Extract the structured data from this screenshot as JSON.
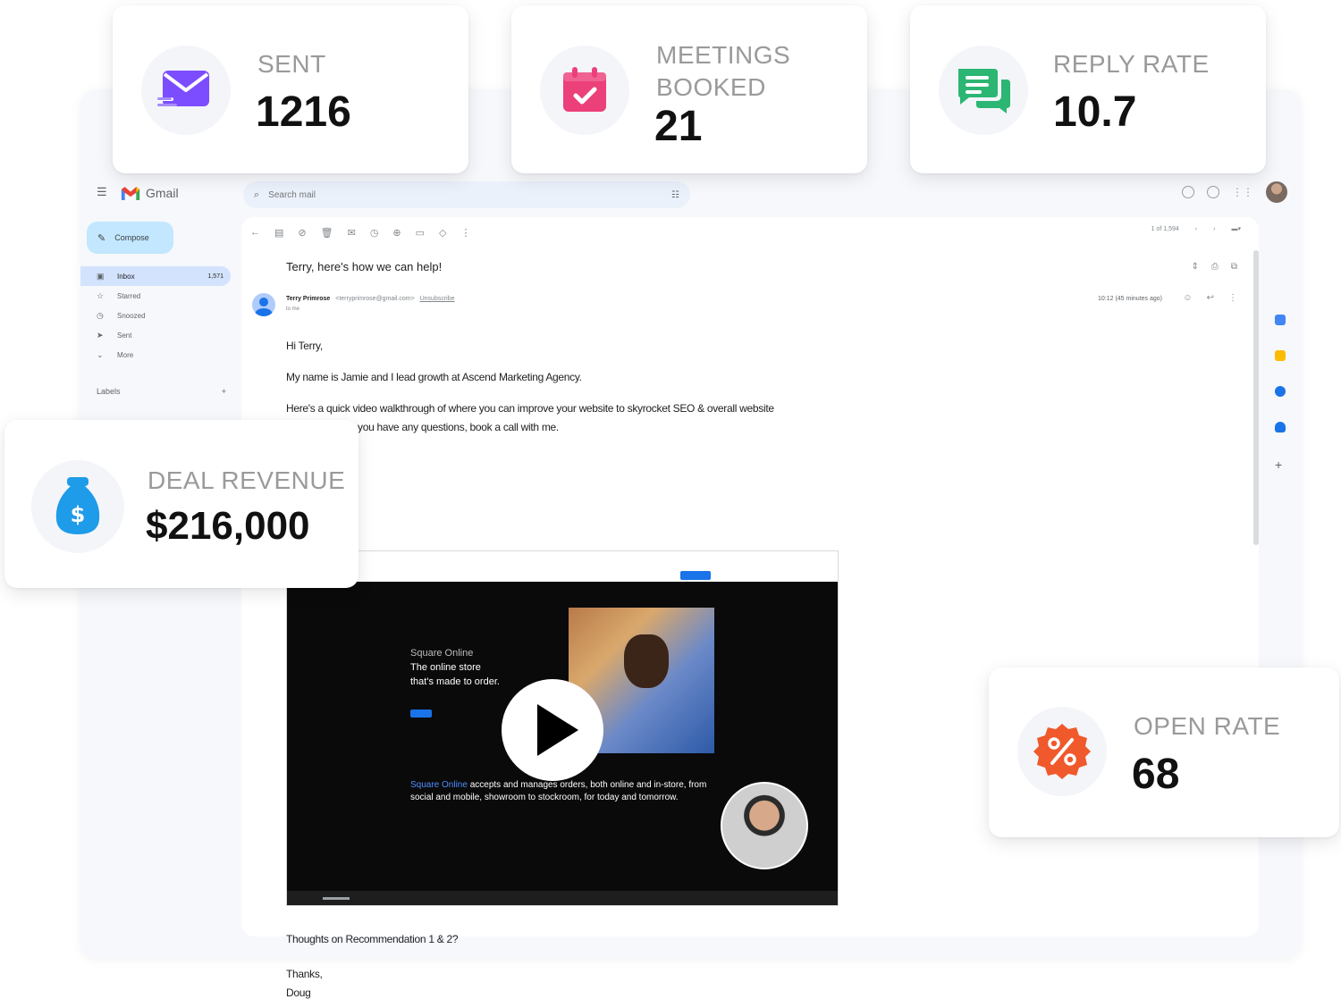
{
  "stats": {
    "sent": {
      "label": "SENT",
      "value": "1216",
      "color": "#7c4dff"
    },
    "meetings": {
      "label_line1": "MEETINGS",
      "label_line2": "BOOKED",
      "value": "21",
      "color": "#ec407a"
    },
    "reply_rate": {
      "label": "REPLY RATE",
      "value": "10.7",
      "color": "#2bb673"
    },
    "deal_revenue": {
      "label": "DEAL REVENUE",
      "value": "$216,000",
      "color": "#1e9be9"
    },
    "open_rate": {
      "label": "OPEN RATE",
      "value": "68",
      "color": "#f0592b"
    }
  },
  "gmail": {
    "app_name": "Gmail",
    "search_placeholder": "Search mail",
    "compose_label": "Compose",
    "nav": [
      {
        "label": "Inbox",
        "count": "1,571",
        "icon": "inbox-icon"
      },
      {
        "label": "Starred",
        "icon": "star-icon"
      },
      {
        "label": "Snoozed",
        "icon": "clock-icon"
      },
      {
        "label": "Sent",
        "icon": "send-icon"
      },
      {
        "label": "More",
        "icon": "chevron-down-icon"
      }
    ],
    "labels_heading": "Labels",
    "pager": "1 of 1,594",
    "email": {
      "subject": "Terry, here's how we can help!",
      "sender_name": "Terry Primrose",
      "sender_email": "<terryprimrose@gmail.com>",
      "unsubscribe": "Unsubscribe",
      "to": "to me",
      "timestamp": "10:12 (45 minutes ago)",
      "greeting": "Hi Terry,",
      "para1": "My name is Jamie and I lead growth at Ascend Marketing Agency.",
      "para2a": "Here's a quick video walkthrough of where you can improve your website to skyrocket SEO & overall website",
      "para2b": "you have any questions, book a call with me.",
      "question": "Thoughts on Recommendation 1 & 2?",
      "signoff": "Thanks,",
      "signature": "Doug"
    },
    "video": {
      "brand": "Square Online",
      "headline_line1": "The online store",
      "headline_line2": "that's made to order.",
      "desc_highlight": "Square Online",
      "desc_rest": "accepts and manages orders, both online and in-store, from social and mobile, showroom to stockroom, for today and tomorrow."
    }
  }
}
